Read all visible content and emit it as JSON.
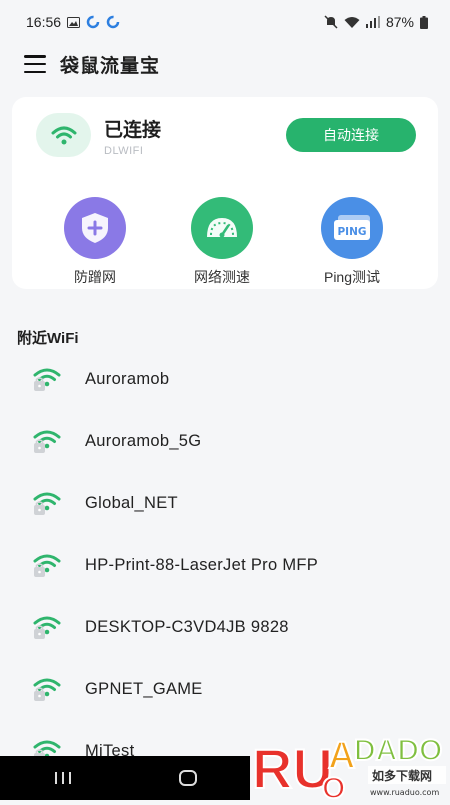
{
  "status_bar": {
    "time": "16:56",
    "battery": "87%"
  },
  "app_bar": {
    "title": "袋鼠流量宝"
  },
  "connection": {
    "status": "已连接",
    "ssid": "DLWIFI",
    "auto_connect_label": "自动连接"
  },
  "tools": [
    {
      "label": "防蹭网",
      "color": "#8a79e6"
    },
    {
      "label": "网络测速",
      "color": "#33bb78"
    },
    {
      "label": "Ping测试",
      "color": "#4a8fe6",
      "badge": "PING"
    }
  ],
  "nearby": {
    "title": "附近WiFi",
    "networks": [
      {
        "name": "Auroramob"
      },
      {
        "name": "Auroramob_5G"
      },
      {
        "name": "Global_NET"
      },
      {
        "name": "HP-Print-88-LaserJet Pro MFP"
      },
      {
        "name": "DESKTOP-C3VD4JB 9828"
      },
      {
        "name": "GPNET_GAME"
      },
      {
        "name": "MiTest"
      }
    ]
  },
  "watermark": {
    "brand": "RUANDADO",
    "subtitle": "如多下载网",
    "url": "www.ruaduo.com"
  },
  "colors": {
    "accent": "#27b36d",
    "wifi_icon": "#2fb56d"
  }
}
